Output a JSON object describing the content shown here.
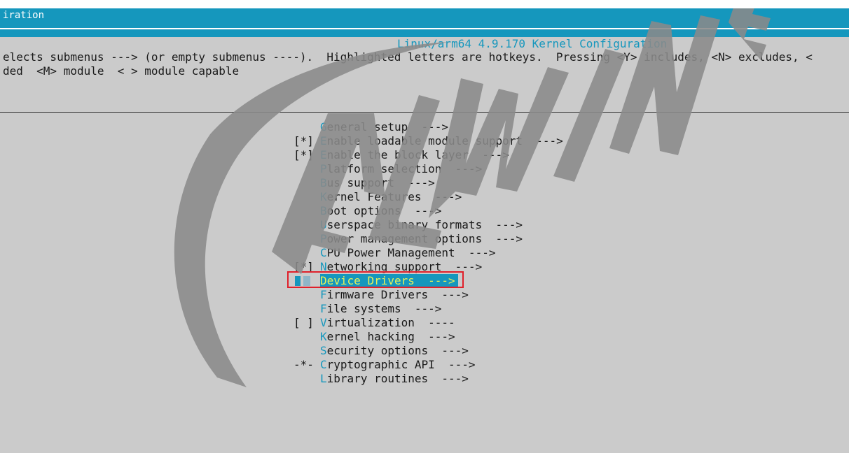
{
  "window": {
    "title": "iration"
  },
  "header": {
    "kernel_title": "Linux/arm64 4.9.170 Kernel Configuration",
    "help_line_1": "elects submenus ---> (or empty submenus ----).  Highlighted letters are hotkeys.  Pressing <Y> includes, <N> excludes, <",
    "help_line_2": "ded  <M> module  < > module capable"
  },
  "menu": {
    "selected_index": 11,
    "items": [
      {
        "prefix": "",
        "hotkey": "G",
        "rest": "eneral setup  --->"
      },
      {
        "prefix": "[*]",
        "hotkey": "E",
        "rest": "nable loadable module support  --->"
      },
      {
        "prefix": "[*]",
        "hotkey": "E",
        "rest": "nable the block layer  --->"
      },
      {
        "prefix": "",
        "hotkey": "P",
        "rest": "latform selection  --->"
      },
      {
        "prefix": "",
        "hotkey": "B",
        "rest": "us support  --->"
      },
      {
        "prefix": "",
        "hotkey": "K",
        "rest": "ernel Features  --->"
      },
      {
        "prefix": "",
        "hotkey": "B",
        "rest": "oot options  --->"
      },
      {
        "prefix": "",
        "hotkey": "U",
        "rest": "serspace binary formats  --->"
      },
      {
        "prefix": "",
        "hotkey": "P",
        "rest": "ower management options  --->"
      },
      {
        "prefix": "",
        "hotkey": "C",
        "rest": "PU Power Management  --->"
      },
      {
        "prefix": "[*]",
        "hotkey": "N",
        "rest": "etworking support  --->"
      },
      {
        "prefix": "",
        "hotkey": "D",
        "rest": "evice Drivers  --->"
      },
      {
        "prefix": "",
        "hotkey": "F",
        "rest": "irmware Drivers  --->"
      },
      {
        "prefix": "",
        "hotkey": "F",
        "rest": "ile systems  --->"
      },
      {
        "prefix": "[ ]",
        "hotkey": "V",
        "rest": "irtualization  ----"
      },
      {
        "prefix": "",
        "hotkey": "K",
        "rest": "ernel hacking  --->"
      },
      {
        "prefix": "",
        "hotkey": "S",
        "rest": "ecurity options  --->"
      },
      {
        "prefix": "-*-",
        "hotkey": "C",
        "rest": "ryptographic API  --->"
      },
      {
        "prefix": "",
        "hotkey": "L",
        "rest": "ibrary routines  --->"
      }
    ]
  },
  "watermark": {
    "text": "ALLWINNER",
    "color": "#8a8a8a"
  },
  "colors": {
    "terminal_bg": "#cbcbcb",
    "title_bar": "#1597bd",
    "hotkey": "#1597bd",
    "selected_text": "#e6f05a",
    "highlight_border": "#e0202a"
  }
}
